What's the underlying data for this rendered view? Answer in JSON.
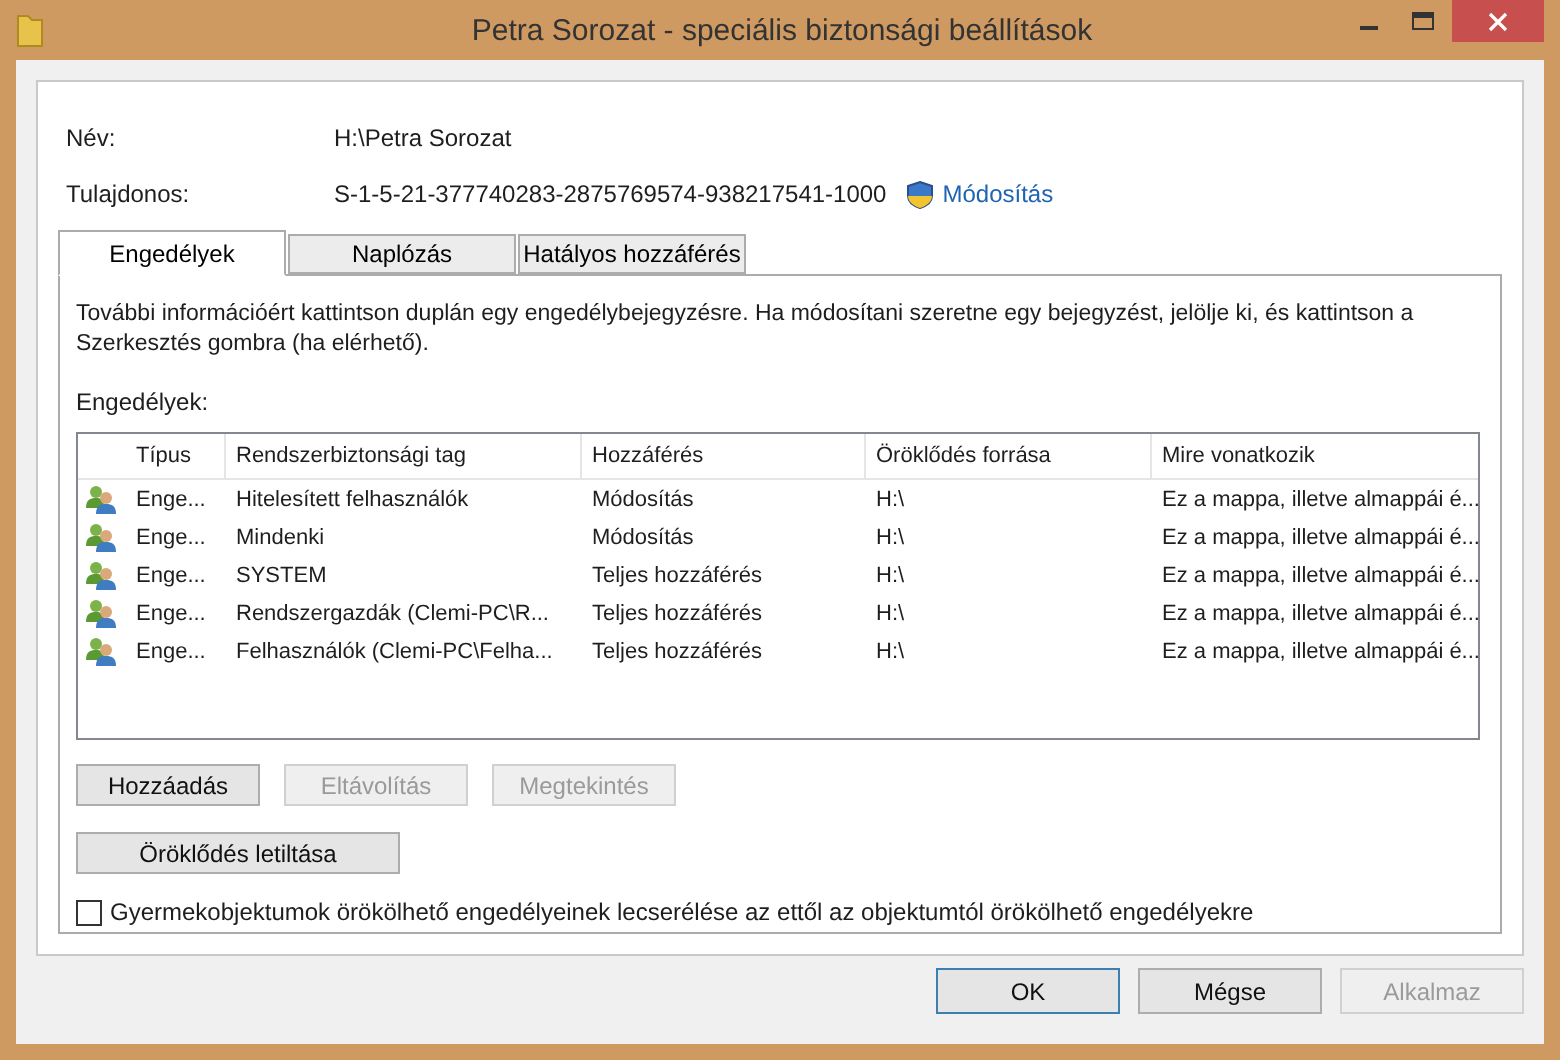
{
  "window": {
    "title": "Petra Sorozat - speciális biztonsági beállítások"
  },
  "name": {
    "label": "Név:",
    "value": "H:\\Petra Sorozat"
  },
  "owner": {
    "label": "Tulajdonos:",
    "value": "S-1-5-21-377740283-2875769574-938217541-1000",
    "link": "Módosítás"
  },
  "tabs": [
    {
      "label": "Engedélyek",
      "selected": true
    },
    {
      "label": "Naplózás",
      "selected": false
    },
    {
      "label": "Hatályos hozzáférés",
      "selected": false
    }
  ],
  "info": "További információért kattintson duplán egy engedélybejegyzésre. Ha módosítani szeretne egy bejegyzést, jelölje ki, és kattintson a Szerkesztés gombra (ha elérhető).",
  "list_label": "Engedélyek:",
  "table": {
    "columns": [
      "Típus",
      "Rendszerbiztonsági tag",
      "Hozzáférés",
      "Öröklődés forrása",
      "Mire vonatkozik"
    ],
    "rows": [
      {
        "cells": [
          "Enge...",
          "Hitelesített felhasználók",
          "Módosítás",
          "H:\\",
          "Ez a mappa, illetve almappái é..."
        ]
      },
      {
        "cells": [
          "Enge...",
          "Mindenki",
          "Módosítás",
          "H:\\",
          "Ez a mappa, illetve almappái é..."
        ]
      },
      {
        "cells": [
          "Enge...",
          "SYSTEM",
          "Teljes hozzáférés",
          "H:\\",
          "Ez a mappa, illetve almappái é..."
        ]
      },
      {
        "cells": [
          "Enge...",
          "Rendszergazdák (Clemi-PC\\R...",
          "Teljes hozzáférés",
          "H:\\",
          "Ez a mappa, illetve almappái é..."
        ]
      },
      {
        "cells": [
          "Enge...",
          "Felhasználók (Clemi-PC\\Felha...",
          "Teljes hozzáférés",
          "H:\\",
          "Ez a mappa, illetve almappái é..."
        ]
      }
    ]
  },
  "entry_buttons": [
    {
      "label": "Hozzáadás",
      "disabled": false
    },
    {
      "label": "Eltávolítás",
      "disabled": true
    },
    {
      "label": "Megtekintés",
      "disabled": true
    }
  ],
  "inheritance_button": {
    "label": "Öröklődés letiltása",
    "disabled": false
  },
  "replace_checkbox": {
    "label": "Gyermekobjektumok örökölhető engedélyeinek lecserélése az ettől az objektumtól örökölhető engedélyekre",
    "checked": false
  },
  "dialog_buttons": [
    {
      "label": "OK",
      "default": true,
      "disabled": false
    },
    {
      "label": "Mégse",
      "default": false,
      "disabled": false
    },
    {
      "label": "Alkalmaz",
      "default": false,
      "disabled": true
    }
  ]
}
